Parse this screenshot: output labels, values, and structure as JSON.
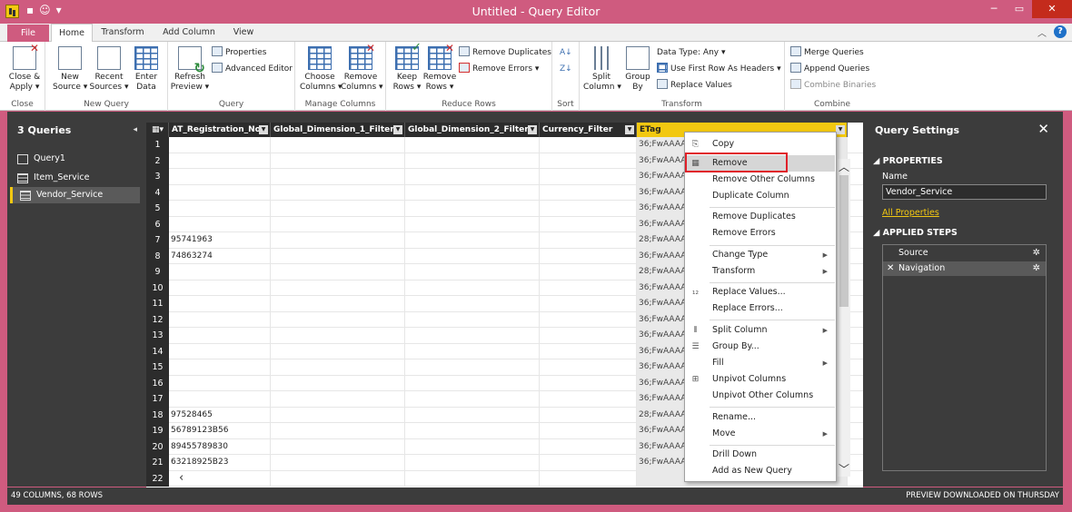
{
  "window": {
    "title": "Untitled - Query Editor"
  },
  "tabs": {
    "file": "File",
    "home": "Home",
    "transform": "Transform",
    "add_column": "Add Column",
    "view": "View"
  },
  "ribbon": {
    "close_apply": "Close &\nApply ▾",
    "new_source": "New\nSource ▾",
    "recent_sources": "Recent\nSources ▾",
    "enter_data": "Enter\nData",
    "refresh_preview": "Refresh\nPreview ▾",
    "properties": "Properties",
    "advanced_editor": "Advanced Editor",
    "choose_columns": "Choose\nColumns ▾",
    "remove_columns": "Remove\nColumns ▾",
    "keep_rows": "Keep\nRows ▾",
    "remove_rows": "Remove\nRows ▾",
    "remove_duplicates": "Remove Duplicates",
    "remove_errors": "Remove Errors ▾",
    "split_column": "Split\nColumn ▾",
    "group_by": "Group\nBy",
    "data_type": "Data Type: Any ▾",
    "use_first_row": "Use First Row As Headers ▾",
    "replace_values": "Replace Values",
    "merge_queries": "Merge Queries",
    "append_queries": "Append Queries",
    "combine_binaries": "Combine Binaries",
    "groups": {
      "close": "Close",
      "new_query": "New Query",
      "query": "Query",
      "manage_columns": "Manage Columns",
      "reduce_rows": "Reduce Rows",
      "sort": "Sort",
      "transform": "Transform",
      "combine": "Combine"
    }
  },
  "queries": {
    "header": "3 Queries",
    "items": [
      "Query1",
      "Item_Service",
      "Vendor_Service"
    ]
  },
  "grid": {
    "columns": [
      "AT_Registration_No",
      "Global_Dimension_1_Filter",
      "Global_Dimension_2_Filter",
      "Currency_Filter",
      "ETag"
    ],
    "row_numbers": [
      "1",
      "2",
      "3",
      "4",
      "5",
      "6",
      "7",
      "8",
      "9",
      "10",
      "11",
      "12",
      "13",
      "14",
      "15",
      "16",
      "17",
      "18",
      "19",
      "20",
      "21",
      "22"
    ],
    "col1_values": [
      "",
      "",
      "",
      "",
      "",
      "",
      "95741963",
      "74863274",
      "",
      "",
      "",
      "",
      "",
      "",
      "",
      "",
      "",
      "97528465",
      "56789123B56",
      "89455789830",
      "63218925B23",
      ""
    ],
    "etag_values": [
      "36;FwAAAAJ",
      "36;FwAAAAJ",
      "36;FwAAAAJ",
      "36;FwAAAAJ",
      "36;FwAAAAJ",
      "36;FwAAAAJ",
      "28;FwAAAAJ",
      "36;FwAAAAJ",
      "28;FwAAAAJ",
      "36;FwAAAAJ",
      "36;FwAAAAJ",
      "36;FwAAAAJ",
      "36;FwAAAAJ",
      "36;FwAAAAJ",
      "36;FwAAAAJ",
      "36;FwAAAAJ",
      "36;FwAAAAJ",
      "28;FwAAAAJ",
      "36;FwAAAAJ",
      "36;FwAAAAJ",
      "36;FwAAAAJ",
      ""
    ]
  },
  "context_menu": {
    "items": [
      "Copy",
      "Remove",
      "Remove Other Columns",
      "Duplicate Column",
      "Remove Duplicates",
      "Remove Errors",
      "Change Type",
      "Transform",
      "Replace Values...",
      "Replace Errors...",
      "Split Column",
      "Group By...",
      "Fill",
      "Unpivot Columns",
      "Unpivot Other Columns",
      "Rename...",
      "Move",
      "Drill Down",
      "Add as New Query"
    ]
  },
  "query_settings": {
    "title": "Query Settings",
    "properties_label": "PROPERTIES",
    "name_label": "Name",
    "name_value": "Vendor_Service",
    "all_properties": "All Properties",
    "applied_steps_label": "APPLIED STEPS",
    "steps": [
      "Source",
      "Navigation"
    ]
  },
  "status": {
    "left": "49 COLUMNS, 68 ROWS",
    "right": "PREVIEW DOWNLOADED ON THURSDAY"
  }
}
